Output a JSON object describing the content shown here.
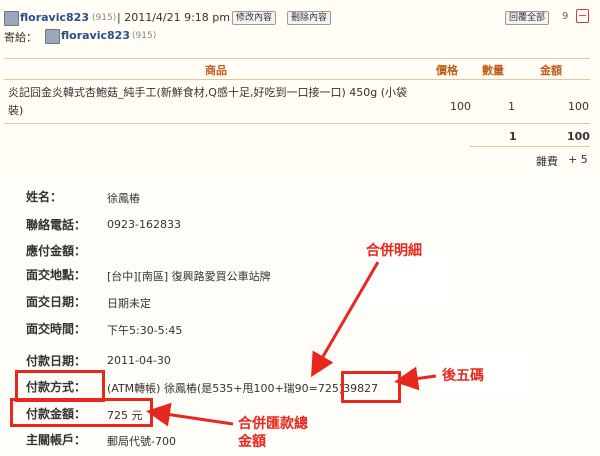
{
  "header": {
    "user": "floravic823",
    "user_count": "(915)",
    "date_time": "| 2011/4/21  9:18 pm",
    "edit_button": "修改內容",
    "delete_button": "刪除內容",
    "reply_all_button": "回覆全部",
    "reply_count": "9",
    "collapse": "−"
  },
  "sent_to": {
    "label": "寄給：",
    "user": "floravic823",
    "user_count": "(915)"
  },
  "table": {
    "columns": [
      "商品",
      "價格",
      "數量",
      "金額"
    ],
    "rows": [
      {
        "product": "炎記囧金炎韓式杏鮑菇_純手工(新鮮食材,Q感十足,好吃到一口接一口) 450g (小袋裝)",
        "price": "100",
        "qty": "1",
        "amount": "100"
      }
    ],
    "total_qty": "1",
    "total_amount": "100",
    "misc_label": "雜費",
    "misc_value": "+ 5"
  },
  "details": [
    {
      "label": "姓名：",
      "value": "徐鳳樁"
    },
    {
      "label": "聯絡電話：",
      "value": "0923-162833"
    },
    {
      "label": "應付金額：",
      "value": ""
    },
    {
      "label": "面交地點：",
      "value": "[台中][南區] 復興路愛買公車站牌"
    },
    {
      "label": "面交日期：",
      "value": "日期未定"
    },
    {
      "label": "面交時間：",
      "value": "下午5:30-5:45"
    },
    {
      "label": "付款日期：",
      "value": "2011-04-30"
    },
    {
      "label": "付款方式：",
      "value": "(ATM轉帳) 徐鳳樁(是535+甩100+瑞90=725)39827"
    },
    {
      "label": "付款金額：",
      "value": "725 元"
    },
    {
      "label": "主關帳戶：",
      "value": "郵局代號-700"
    }
  ],
  "annotations": {
    "merge_detail": "合併明細",
    "last_five": "後五碼",
    "merge_total_line1": "合併匯款總",
    "merge_total_line2": "金額"
  },
  "colors": {
    "annotation": "#e8281e",
    "header_text": "#c15e1c",
    "link": "#2a4e8a"
  }
}
